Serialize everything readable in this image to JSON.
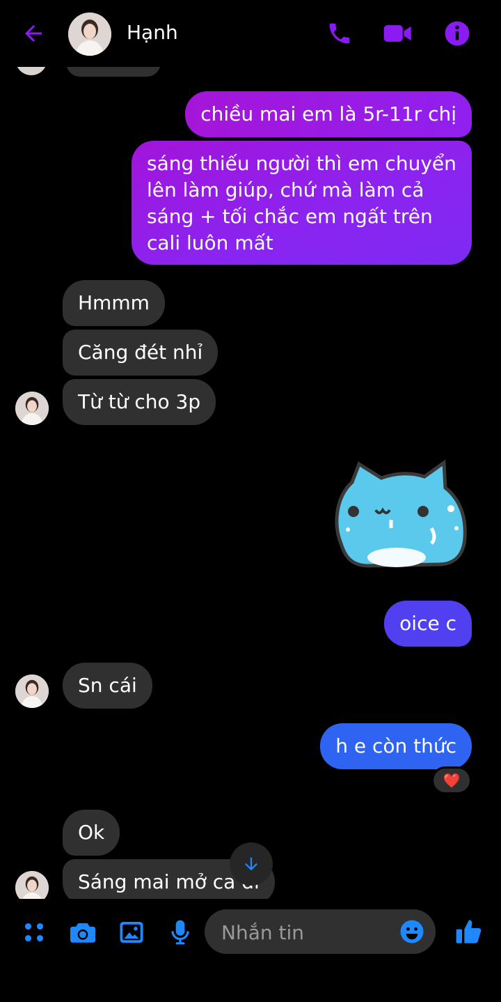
{
  "header": {
    "contact_name": "Hạnh",
    "back_icon": "arrow-left-icon",
    "call_icon": "phone-icon",
    "video_icon": "video-camera-icon",
    "info_icon": "info-icon",
    "accent_color": "#8a1cf2"
  },
  "messages": [
    {
      "id": "m1",
      "direction": "outgoing",
      "text": "chiều mai em là 5r-11r chị"
    },
    {
      "id": "m2",
      "direction": "outgoing",
      "text": "sáng thiếu người thì em chuyển lên làm giúp, chứ mà làm cả sáng + tối chắc em ngất trên cali luôn mất"
    },
    {
      "id": "m3",
      "direction": "incoming",
      "text": "Hmmm"
    },
    {
      "id": "m4",
      "direction": "incoming",
      "text": "Căng đét nhỉ"
    },
    {
      "id": "m5",
      "direction": "incoming",
      "text": "Từ từ cho 3p"
    },
    {
      "id": "m6",
      "direction": "outgoing",
      "type": "sticker",
      "sticker": "blue-cat-sticker"
    },
    {
      "id": "m7",
      "direction": "outgoing",
      "text": "oice c"
    },
    {
      "id": "m8",
      "direction": "incoming",
      "text": "Sn cái"
    },
    {
      "id": "m9",
      "direction": "outgoing",
      "text": "h e còn thức",
      "reaction": "❤️"
    },
    {
      "id": "m10",
      "direction": "incoming",
      "text": "Ok"
    },
    {
      "id": "m11",
      "direction": "incoming",
      "text": "Sáng mai mở ca đi"
    }
  ],
  "scroll_down_icon": "arrow-down-icon",
  "composer": {
    "placeholder": "Nhắn tin",
    "tools": [
      "grid-menu-icon",
      "camera-icon",
      "image-icon",
      "microphone-icon"
    ],
    "emoji_icon": "emoji-icon",
    "like_icon": "thumbs-up-icon",
    "tool_color": "#1e88ff"
  }
}
